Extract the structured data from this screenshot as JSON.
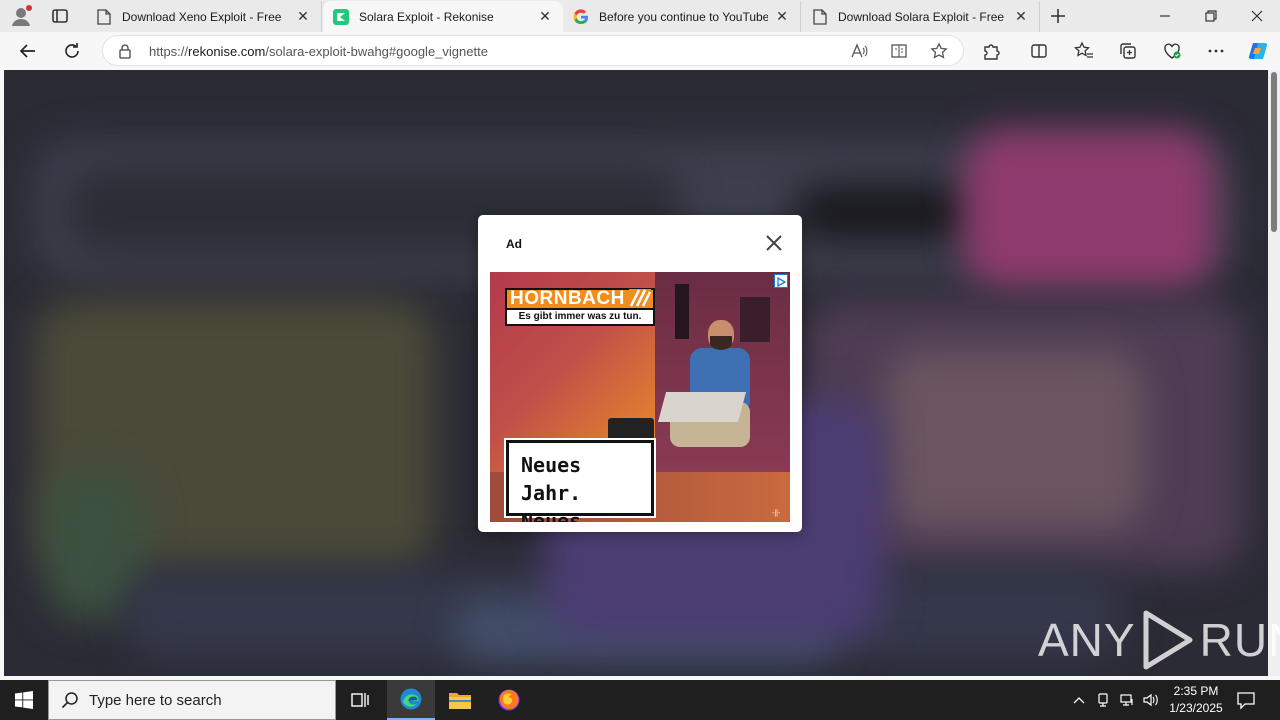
{
  "tabs": [
    {
      "title": "Download Xeno Exploit - Free",
      "icon": "page-icon",
      "active": false
    },
    {
      "title": "Solara Exploit - Rekonise",
      "icon": "rekonise-icon",
      "active": true
    },
    {
      "title": "Before you continue to YouTube",
      "icon": "google-icon",
      "active": false
    },
    {
      "title": "Download Solara Exploit - Free",
      "icon": "page-icon",
      "active": false
    }
  ],
  "address_bar": {
    "url_prefix": "https://",
    "url_host": "rekonise.com",
    "url_path": "/solara-exploit-bwahg#google_vignette"
  },
  "modal": {
    "label": "Ad",
    "close_icon": "close-icon"
  },
  "ad": {
    "brand": "HORNBACH",
    "tagline": "Es gibt immer was zu tun.",
    "slogan_line1": "Neues Jahr.",
    "slogan_line2": "Neues Bad.",
    "brand_color": "#f28c1c"
  },
  "watermark": {
    "left": "ANY",
    "right": "RUN"
  },
  "taskbar": {
    "search_placeholder": "Type here to search",
    "time": "2:35 PM",
    "date": "1/23/2025"
  },
  "colors": {
    "accent": "#0078d4",
    "taskbar_bg": "#1f1f1f"
  }
}
